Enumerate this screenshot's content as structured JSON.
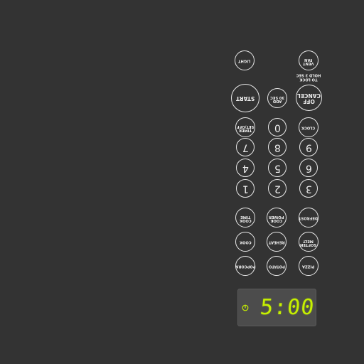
{
  "colors": {
    "panel": "#333333",
    "button_outline": "#e8e8e8",
    "display_background": "#4c4c4c",
    "display_digits": "#c6f000"
  },
  "buttons": {
    "light": "LIGHT",
    "vent_fan": "VENT\nFAN",
    "start": "START",
    "add_30_sec": "ADD\n30 SEC",
    "cancel_off": "OFF\nCANCEL",
    "timer": "TIMER\nSET/OFF",
    "zero": "0",
    "clock": "CLOCK",
    "seven": "7",
    "eight": "8",
    "nine": "9",
    "four": "4",
    "five": "5",
    "six": "6",
    "one": "1",
    "two": "2",
    "three": "3",
    "time_cook": "COOK\nTIME",
    "power_cook": "COOK\nPOWER",
    "defrost": "DEFROST",
    "cook": "COOK",
    "reheat": "REHEAT",
    "melt_soften": "SOFTEN\nMELT",
    "popcorn": "POPCORN",
    "potato": "POTATO",
    "pizza": "PIZZA"
  },
  "hold_to_lock": "TO LOCK\nHOLD 3 SEC",
  "display": {
    "time": "5:00",
    "icon": "eco-leaf-icon"
  }
}
